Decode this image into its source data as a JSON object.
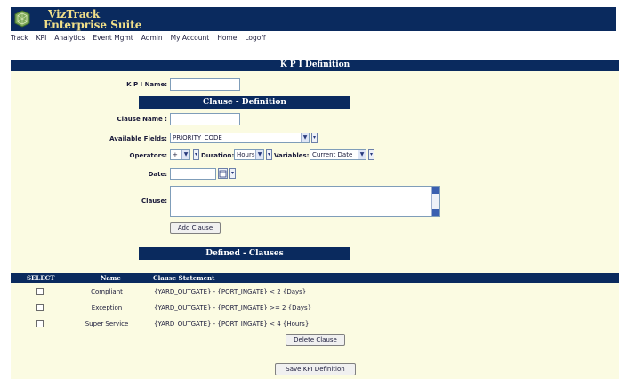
{
  "app": {
    "title_line1": "VizTrack",
    "title_line2": "Enterprise Suite",
    "logo_icon": "globe-cube-icon"
  },
  "nav": [
    "Track",
    "KPI",
    "Analytics",
    "Event Mgmt",
    "Admin",
    "My Account",
    "Home",
    "Logoff"
  ],
  "page_title": "K P I Definition",
  "kpi": {
    "name_label": "K P I Name:",
    "name_value": ""
  },
  "clause_section": {
    "title": "Clause - Definition",
    "clause_name_label": "Clause Name :",
    "clause_name_value": "",
    "available_fields_label": "Available Fields:",
    "available_fields_value": "PRIORITY_CODE",
    "operators_label": "Operators:",
    "operators_value": "+",
    "duration_label": "Duration:",
    "duration_value": "Hours",
    "variables_label": "Variables:",
    "variables_value": "Current Date",
    "date_label": "Date:",
    "date_value": "",
    "clause_label": "Clause:",
    "clause_value": "",
    "add_button": "Add Clause"
  },
  "defined_section": {
    "title": "Defined - Clauses",
    "columns": [
      "SELECT",
      "Name",
      "Clause Statement"
    ],
    "rows": [
      {
        "name": "Compliant",
        "statement": "{YARD_OUTGATE} - {PORT_INGATE} <  2 {Days}",
        "checked": false
      },
      {
        "name": "Exception",
        "statement": "{YARD_OUTGATE} - {PORT_INGATE} >= 2 {Days}",
        "checked": false
      },
      {
        "name": "Super Service",
        "statement": "{YARD_OUTGATE} - {PORT_INGATE} < 4 {Hours}",
        "checked": false
      }
    ],
    "delete_button": "Delete Clause"
  },
  "save_button": "Save KPI Definition",
  "colors": {
    "header_bg": "#0a2a5e",
    "title_text": "#f2e08a",
    "form_bg": "#fbfbe2"
  }
}
